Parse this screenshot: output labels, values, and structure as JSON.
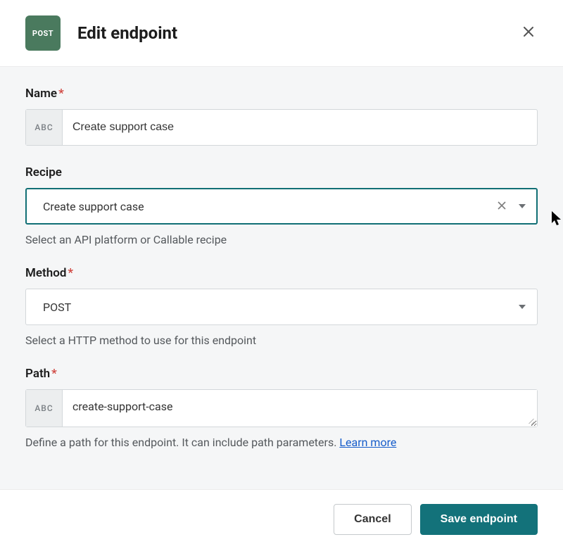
{
  "header": {
    "badge": "POST",
    "title": "Edit endpoint"
  },
  "name": {
    "label": "Name",
    "required": "*",
    "prefix": "ABC",
    "value": "Create support case"
  },
  "recipe": {
    "label": "Recipe",
    "value": "Create support case",
    "helper": "Select an API platform or Callable recipe"
  },
  "method": {
    "label": "Method",
    "required": "*",
    "value": "POST",
    "helper": "Select a HTTP method to use for this endpoint"
  },
  "path": {
    "label": "Path",
    "required": "*",
    "prefix": "ABC",
    "value": "create-support-case",
    "helper": "Define a path for this endpoint. It can include path parameters. ",
    "learn": "Learn more"
  },
  "footer": {
    "cancel": "Cancel",
    "save": "Save endpoint"
  }
}
